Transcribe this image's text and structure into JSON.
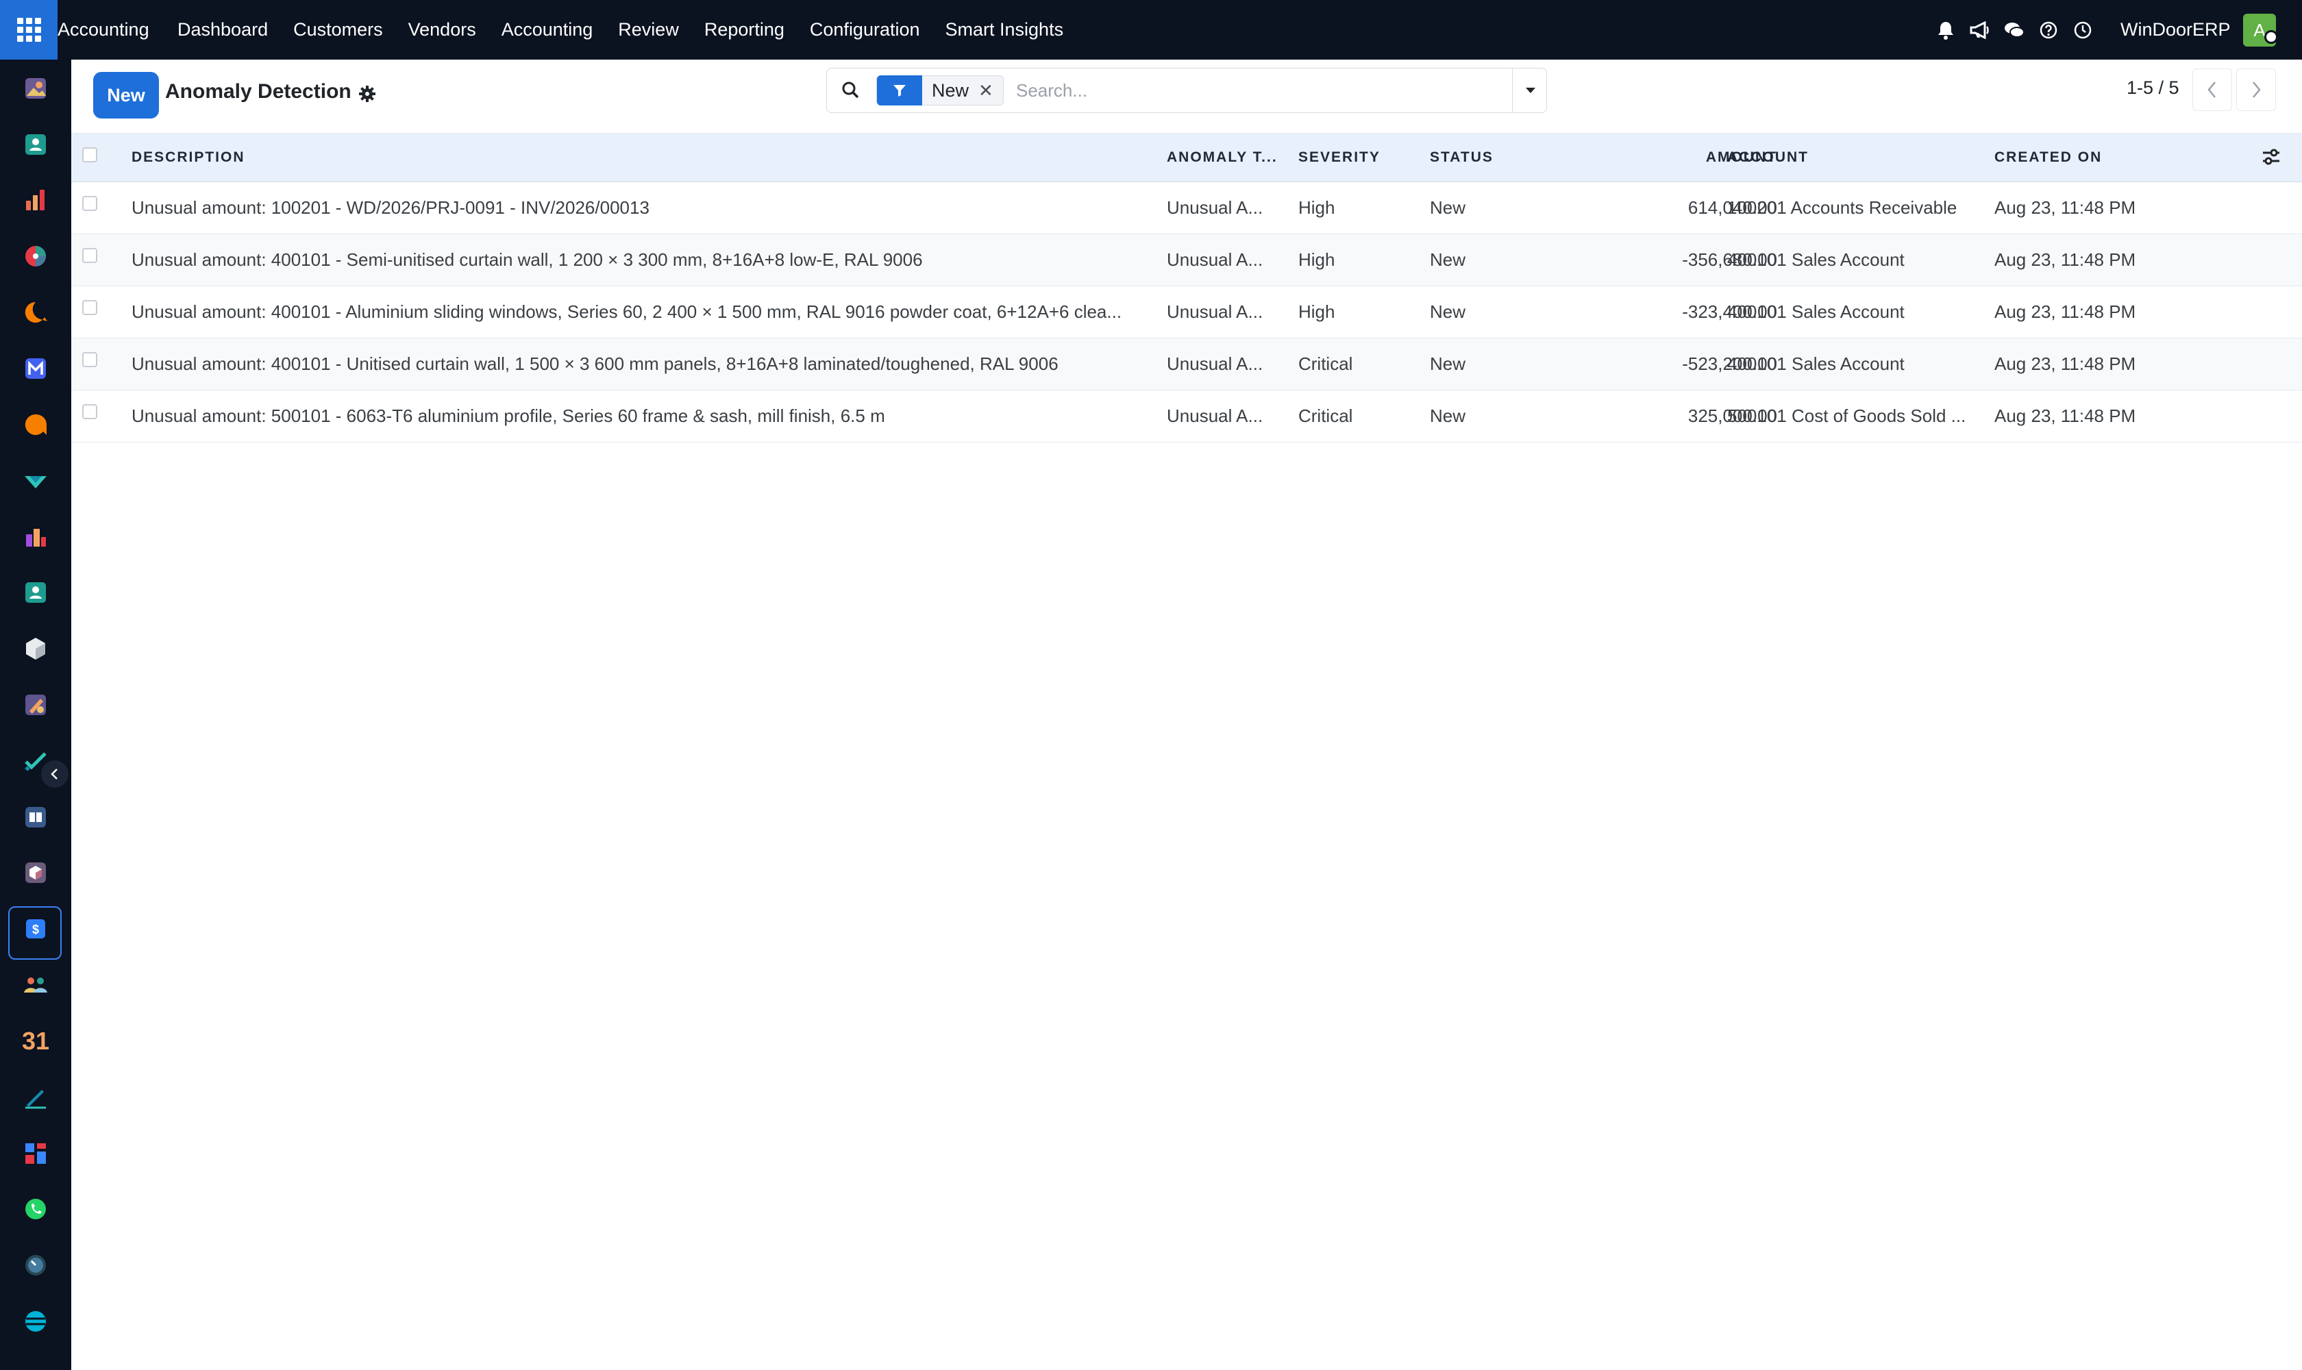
{
  "topbar": {
    "brand": "Accounting",
    "menu": [
      "Dashboard",
      "Customers",
      "Vendors",
      "Accounting",
      "Review",
      "Reporting",
      "Configuration",
      "Smart Insights"
    ],
    "company": "WinDoorERP",
    "avatar_initial": "A",
    "icons": [
      "bell-icon",
      "megaphone-icon",
      "chat-icon",
      "help-icon",
      "clock-icon"
    ]
  },
  "dock": {
    "apps": [
      "photo-app-icon",
      "contacts-app-icon",
      "charts-app-icon",
      "pie-app-icon",
      "discuss-app-icon",
      "mail-app-icon",
      "livechat-app-icon",
      "sign-app-icon",
      "reporting-app-icon",
      "employees-app-icon",
      "inventory-app-icon",
      "studio-app-icon",
      "tasks-app-icon",
      "knowledge-app-icon",
      "barcode-app-icon",
      "accounting-app-icon",
      "team-app-icon",
      "calendar-app-icon",
      "sign-pen-app-icon",
      "dashboard-app-icon",
      "whatsapp-app-icon",
      "timer-app-icon",
      "website-app-icon"
    ],
    "calendar_label": "31"
  },
  "control": {
    "new_label": "New",
    "title": "Anomaly Detection",
    "facet_value": "New",
    "search_placeholder": "Search...",
    "pager": "1-5 / 5"
  },
  "table": {
    "headers": {
      "description": "DESCRIPTION",
      "anomaly_type": "ANOMALY T...",
      "severity": "SEVERITY",
      "status": "STATUS",
      "amount": "AMOUNT",
      "account": "ACCOUNT",
      "created_on": "CREATED ON"
    },
    "rows": [
      {
        "description": "Unusual amount: 100201 - WD/2026/PRJ-0091 - INV/2026/00013",
        "anomaly_type": "Unusual A...",
        "severity": "High",
        "status": "New",
        "amount": "614,040.00",
        "account": "100201 Accounts Receivable",
        "created_on": "Aug 23, 11:48 PM"
      },
      {
        "description": "Unusual amount: 400101 - Semi-unitised curtain wall, 1 200 × 3 300 mm, 8+16A+8 low-E, RAL 9006",
        "anomaly_type": "Unusual A...",
        "severity": "High",
        "status": "New",
        "amount": "-356,680.00",
        "account": "400101 Sales Account",
        "created_on": "Aug 23, 11:48 PM"
      },
      {
        "description": "Unusual amount: 400101 - Aluminium sliding windows, Series 60, 2 400 × 1 500 mm, RAL 9016 powder coat, 6+12A+6 clea...",
        "anomaly_type": "Unusual A...",
        "severity": "High",
        "status": "New",
        "amount": "-323,400.00",
        "account": "400101 Sales Account",
        "created_on": "Aug 23, 11:48 PM"
      },
      {
        "description": "Unusual amount: 400101 - Unitised curtain wall, 1 500 × 3 600 mm panels, 8+16A+8 laminated/toughened, RAL 9006",
        "anomaly_type": "Unusual A...",
        "severity": "Critical",
        "status": "New",
        "amount": "-523,200.00",
        "account": "400101 Sales Account",
        "created_on": "Aug 23, 11:48 PM"
      },
      {
        "description": "Unusual amount: 500101 - 6063-T6 aluminium profile, Series 60 frame & sash, mill finish, 6.5 m",
        "anomaly_type": "Unusual A...",
        "severity": "Critical",
        "status": "New",
        "amount": "325,000.00",
        "account": "500101 Cost of Goods Sold ...",
        "created_on": "Aug 23, 11:48 PM"
      }
    ]
  },
  "colors": {
    "topbar_bg": "#0b1220",
    "primary": "#1e6fd9",
    "avatar": "#61b146",
    "header_bg": "#e8f0fb"
  }
}
